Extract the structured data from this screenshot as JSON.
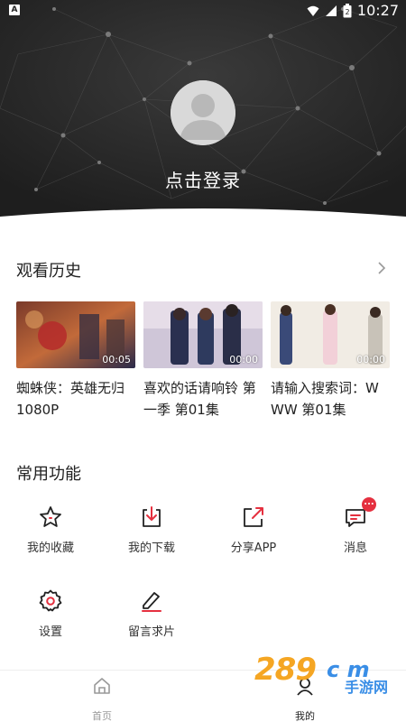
{
  "status_bar": {
    "left_indicator": "A",
    "battery_level": "2",
    "time": "10:27"
  },
  "profile": {
    "login_label": "点击登录"
  },
  "watch_history": {
    "title": "观看历史",
    "items": [
      {
        "title": "蜘蛛侠：英雄无归 1080P",
        "duration": "00:05"
      },
      {
        "title": "喜欢的话请响铃 第一季 第01集",
        "duration": "00:00"
      },
      {
        "title": "请输入搜索词：WWW 第01集",
        "duration": "00:00"
      }
    ]
  },
  "functions": {
    "title": "常用功能",
    "items": [
      {
        "label": "我的收藏",
        "icon": "star-icon"
      },
      {
        "label": "我的下载",
        "icon": "download-icon"
      },
      {
        "label": "分享APP",
        "icon": "share-icon"
      },
      {
        "label": "消息",
        "icon": "message-icon",
        "badge": "..."
      },
      {
        "label": "设置",
        "icon": "gear-icon"
      },
      {
        "label": "留言求片",
        "icon": "edit-icon"
      }
    ]
  },
  "bottom_nav": {
    "items": [
      {
        "label": "首页",
        "icon": "home-icon",
        "active": false
      },
      {
        "label": "我的",
        "icon": "profile-icon",
        "active": true
      }
    ]
  },
  "watermark": {
    "number": "289",
    "suffix": "c m",
    "subtitle": "手游网"
  },
  "colors": {
    "header_bg": "#2a2a2a",
    "accent_red": "#e5303f",
    "text_primary": "#222222"
  }
}
